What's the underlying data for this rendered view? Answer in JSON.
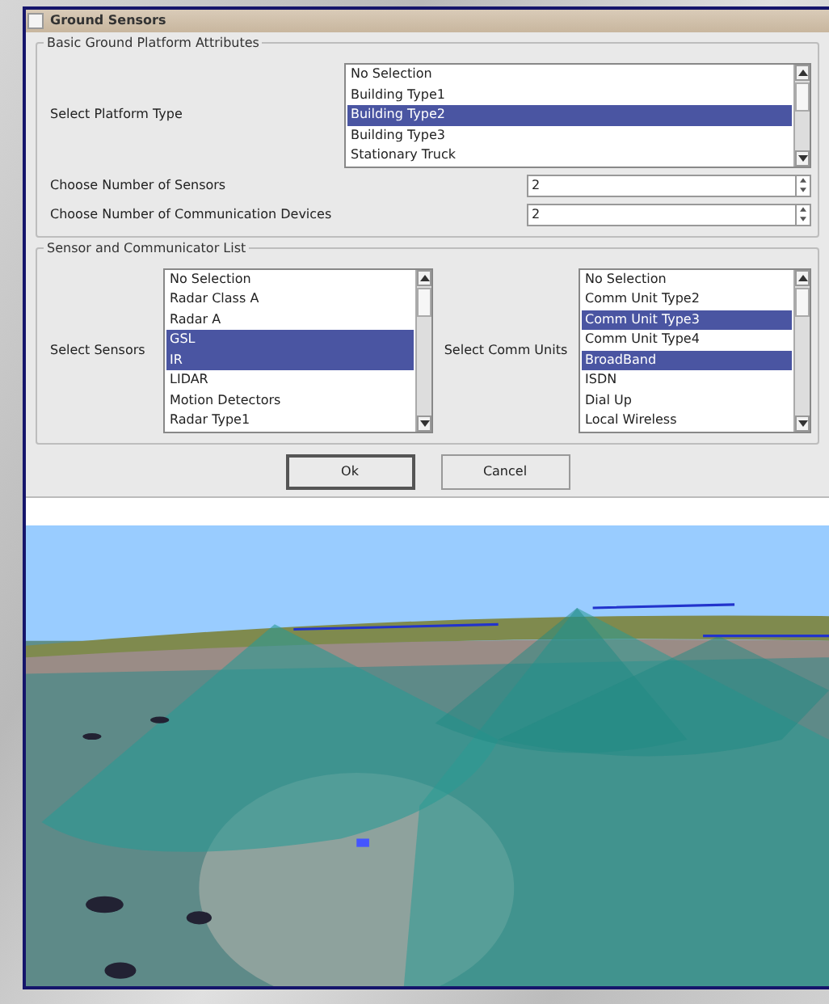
{
  "window": {
    "title": "Ground Sensors"
  },
  "basic_attributes": {
    "title": "Basic Ground Platform Attributes",
    "platform_type": {
      "label": "Select Platform Type",
      "options": [
        {
          "label": "No Selection",
          "selected": false
        },
        {
          "label": "Building Type1",
          "selected": false
        },
        {
          "label": "Building Type2",
          "selected": true
        },
        {
          "label": "Building Type3",
          "selected": false
        },
        {
          "label": "Stationary Truck",
          "selected": false
        }
      ]
    },
    "sensor_count": {
      "label": "Choose Number of Sensors",
      "value": "2"
    },
    "comm_count": {
      "label": "Choose Number of Communication Devices",
      "value": "2"
    }
  },
  "sensor_list": {
    "title": "Sensor and Communicator List",
    "sensors": {
      "label": "Select Sensors",
      "options": [
        {
          "label": "No Selection",
          "selected": false
        },
        {
          "label": "Radar Class A",
          "selected": false
        },
        {
          "label": "Radar A",
          "selected": false
        },
        {
          "label": "GSL",
          "selected": true
        },
        {
          "label": "IR",
          "selected": true
        },
        {
          "label": "LIDAR",
          "selected": false
        },
        {
          "label": "Motion Detectors",
          "selected": false
        },
        {
          "label": "Radar Type1",
          "selected": false
        }
      ]
    },
    "comm_units": {
      "label": "Select Comm Units",
      "options": [
        {
          "label": "No Selection",
          "selected": false
        },
        {
          "label": "Comm Unit Type2",
          "selected": false
        },
        {
          "label": "Comm Unit Type3",
          "selected": true
        },
        {
          "label": "Comm Unit Type4",
          "selected": false
        },
        {
          "label": "BroadBand",
          "selected": true
        },
        {
          "label": "ISDN",
          "selected": false
        },
        {
          "label": "Dial Up",
          "selected": false
        },
        {
          "label": "Local Wireless",
          "selected": false
        }
      ]
    }
  },
  "buttons": [
    {
      "label": "Ok",
      "default": true
    },
    {
      "label": "Cancel",
      "default": false
    }
  ]
}
